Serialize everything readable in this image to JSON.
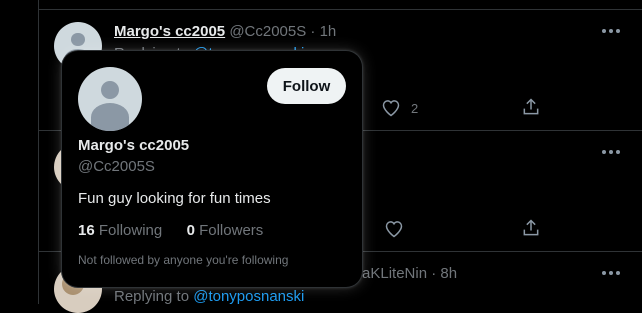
{
  "tweet1": {
    "display_name": "Margo's cc2005",
    "handle": "@Cc2005S",
    "separator": "·",
    "time": "1h",
    "replying_prefix": "Replying to",
    "replying_to": "@tonyposnanski",
    "like_count": "2"
  },
  "tweet3": {
    "handle_fragment": "aKLiteNin",
    "separator": "·",
    "time": "8h",
    "replying_prefix": "Replying to",
    "replying_to": "@tonyposnanski"
  },
  "hover_card": {
    "follow_label": "Follow",
    "display_name": "Margo's cc2005",
    "handle": "@Cc2005S",
    "bio": "Fun guy looking for fun times",
    "following_count": "16",
    "following_label": "Following",
    "followers_count": "0",
    "followers_label": "Followers",
    "note": "Not followed by anyone you're following"
  },
  "icons": {
    "more": "more-horizontal-icon",
    "like": "heart-icon",
    "share": "share-icon"
  },
  "colors": {
    "background": "#000000",
    "text": "#e7e9ea",
    "muted": "#71767b",
    "link": "#1d9bf0",
    "border": "#2f3336",
    "follow_button": "#eff3f4"
  }
}
